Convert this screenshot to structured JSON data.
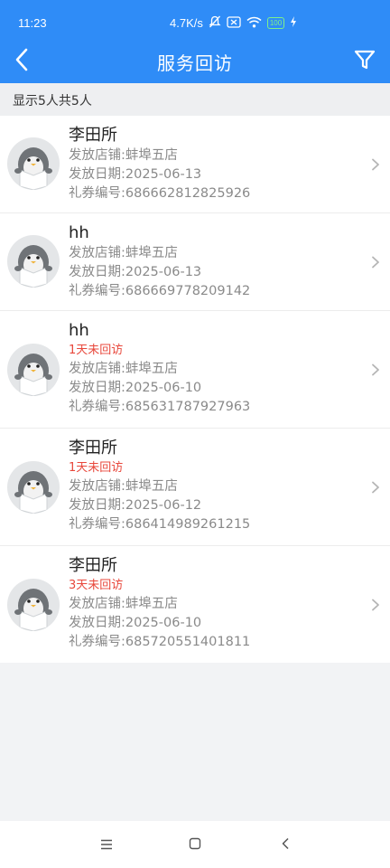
{
  "status_bar": {
    "time": "11:23",
    "speed": "4.7K/s",
    "battery": "100"
  },
  "header": {
    "title": "服务回访",
    "back_icon": "chevron-left-icon",
    "filter_icon": "filter-icon"
  },
  "summary": "显示5人共5人",
  "records": [
    {
      "name": "李田所",
      "tag": "",
      "store": "发放店铺:蚌埠五店",
      "date": "发放日期:2025-06-13",
      "coupon": "礼券编号:686662812825926"
    },
    {
      "name": "hh",
      "tag": "",
      "store": "发放店铺:蚌埠五店",
      "date": "发放日期:2025-06-13",
      "coupon": "礼券编号:686669778209142"
    },
    {
      "name": "hh",
      "tag": "1天未回访",
      "store": "发放店铺:蚌埠五店",
      "date": "发放日期:2025-06-10",
      "coupon": "礼券编号:685631787927963"
    },
    {
      "name": "李田所",
      "tag": "1天未回访",
      "store": "发放店铺:蚌埠五店",
      "date": "发放日期:2025-06-12",
      "coupon": "礼券编号:686414989261215"
    },
    {
      "name": "李田所",
      "tag": "3天未回访",
      "store": "发放店铺:蚌埠五店",
      "date": "发放日期:2025-06-10",
      "coupon": "礼券编号:685720551401811"
    }
  ],
  "colors": {
    "primary": "#2f8cf7",
    "warning_text": "#e8473b"
  }
}
